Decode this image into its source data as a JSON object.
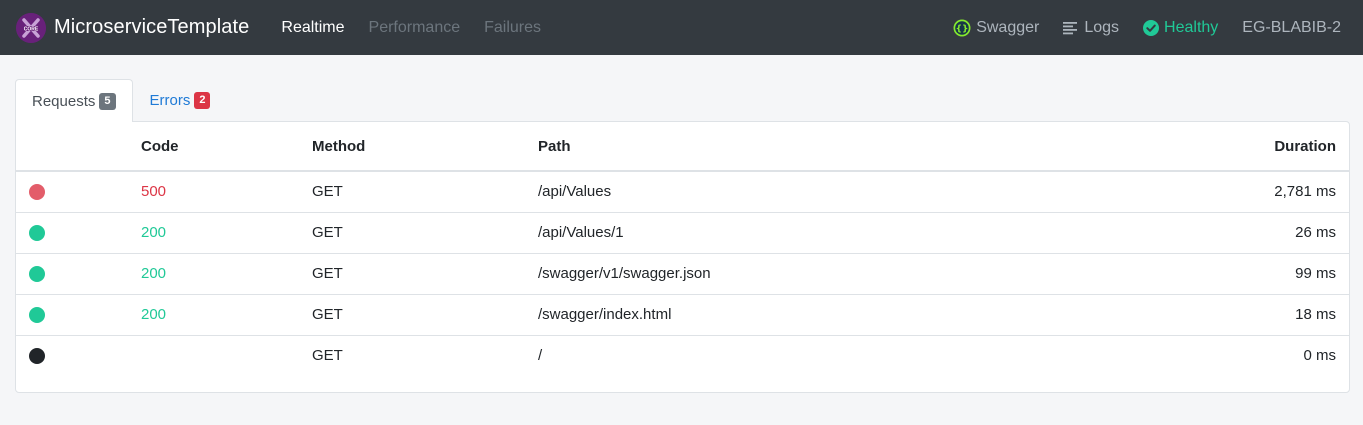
{
  "app": {
    "title": "MicroserviceTemplate"
  },
  "nav": {
    "links": [
      {
        "label": "Realtime",
        "state": "active"
      },
      {
        "label": "Performance",
        "state": "disabled"
      },
      {
        "label": "Failures",
        "state": "disabled"
      }
    ],
    "right": {
      "swagger_label": "Swagger",
      "logs_label": "Logs",
      "health_label": "Healthy",
      "host_label": "EG-BLABIB-2"
    }
  },
  "tabs": [
    {
      "label": "Requests",
      "badge": "5",
      "badge_color": "#6c757d",
      "active": true
    },
    {
      "label": "Errors",
      "badge": "2",
      "badge_color": "#dc3545",
      "active": false
    }
  ],
  "table": {
    "headers": {
      "status": "",
      "code": "Code",
      "method": "Method",
      "path": "Path",
      "duration": "Duration"
    },
    "rows": [
      {
        "status_color": "#e35d6a",
        "code": "500",
        "method": "GET",
        "path": "/api/Values",
        "duration": "2,781 ms"
      },
      {
        "status_color": "#20c997",
        "code": "200",
        "method": "GET",
        "path": "/api/Values/1",
        "duration": "26 ms"
      },
      {
        "status_color": "#20c997",
        "code": "200",
        "method": "GET",
        "path": "/swagger/v1/swagger.json",
        "duration": "99 ms"
      },
      {
        "status_color": "#20c997",
        "code": "200",
        "method": "GET",
        "path": "/swagger/index.html",
        "duration": "18 ms"
      },
      {
        "status_color": "#212529",
        "code": "",
        "method": "GET",
        "path": "/",
        "duration": "0 ms"
      }
    ]
  },
  "colors": {
    "navbar_bg": "#343a40",
    "healthy": "#20c997",
    "error": "#dc3545",
    "link": "#1f7ad6",
    "logo_bg": "#68217a",
    "swagger_green": "#85ea2d"
  },
  "icons": {
    "logo": "dotnet-core-logo-icon",
    "swagger": "swagger-icon",
    "logs": "logs-lines-icon",
    "health": "check-circle-icon"
  }
}
